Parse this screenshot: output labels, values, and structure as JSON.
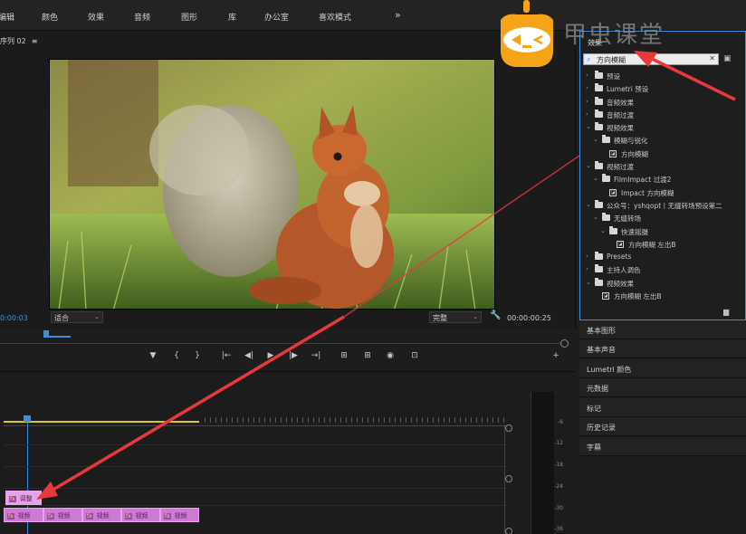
{
  "menu": [
    "编辑",
    "颜色",
    "效果",
    "音频",
    "图形",
    "库",
    "办公室",
    "喜欢模式"
  ],
  "menu_more": "»",
  "monitor": {
    "title": "序列 02",
    "menu_icon": "≡",
    "timecode_left": "0:00:03",
    "fit": "适合",
    "quality": "完整",
    "timecode_right": "00:00:00:25"
  },
  "transport_buttons": [
    "▼",
    "{",
    "}",
    "|←",
    "◀|",
    "▶",
    "|▶",
    "→|",
    "⊞",
    "⊞",
    "◉",
    "⊡",
    "+"
  ],
  "timeline": {
    "adjust_clip": "调整",
    "clips": [
      "视频",
      "视频",
      "视频",
      "视频",
      "视频"
    ],
    "fx": "fx",
    "meter_labels": [
      "-6",
      "-12",
      "-18",
      "-24",
      "-30",
      "-36"
    ]
  },
  "effects": {
    "title": "效果",
    "search_value": "方向模糊",
    "clear": "✕",
    "tree": [
      {
        "level": 0,
        "caret": "›",
        "icon": "folder",
        "label": "预设"
      },
      {
        "level": 0,
        "caret": "›",
        "icon": "folder",
        "label": "Lumetri 预设"
      },
      {
        "level": 0,
        "caret": "›",
        "icon": "folder",
        "label": "音频效果"
      },
      {
        "level": 0,
        "caret": "›",
        "icon": "folder",
        "label": "音频过渡"
      },
      {
        "level": 0,
        "caret": "⌄",
        "icon": "folder",
        "label": "视频效果"
      },
      {
        "level": 1,
        "caret": "⌄",
        "icon": "folder",
        "label": "模糊与锐化"
      },
      {
        "level": 2,
        "caret": "",
        "icon": "fx",
        "label": "方向模糊"
      },
      {
        "level": 0,
        "caret": "⌄",
        "icon": "folder",
        "label": "视频过渡"
      },
      {
        "level": 1,
        "caret": "⌄",
        "icon": "folder",
        "label": "FilmImpact 过渡2"
      },
      {
        "level": 2,
        "caret": "",
        "icon": "fx",
        "label": "Impact 方向模糊"
      },
      {
        "level": 0,
        "caret": "⌄",
        "icon": "folder",
        "label": "公众号：yshqopt丨无缝转场预设第二"
      },
      {
        "level": 1,
        "caret": "⌄",
        "icon": "folder",
        "label": "无缝转场"
      },
      {
        "level": 2,
        "caret": "⌄",
        "icon": "folder",
        "label": "快速摇摄"
      },
      {
        "level": 3,
        "caret": "",
        "icon": "fx",
        "label": "方向模糊 左出B"
      },
      {
        "level": 0,
        "caret": "›",
        "icon": "folder",
        "label": "Presets"
      },
      {
        "level": 0,
        "caret": "›",
        "icon": "folder",
        "label": "主持人调色"
      },
      {
        "level": 0,
        "caret": "⌄",
        "icon": "folder",
        "label": "视频效果"
      },
      {
        "level": 1,
        "caret": "",
        "icon": "fx",
        "label": "方向模糊 左出B"
      }
    ]
  },
  "panels": [
    "基本图形",
    "基本声音",
    "Lumetri 颜色",
    "元数据",
    "标记",
    "历史记录",
    "字幕"
  ],
  "watermark": "甲虫课堂",
  "colors": {
    "accent": "#3f8fe0",
    "clip": "#cf79d7",
    "arrow": "#e8393a",
    "logo": "#f5a419"
  }
}
